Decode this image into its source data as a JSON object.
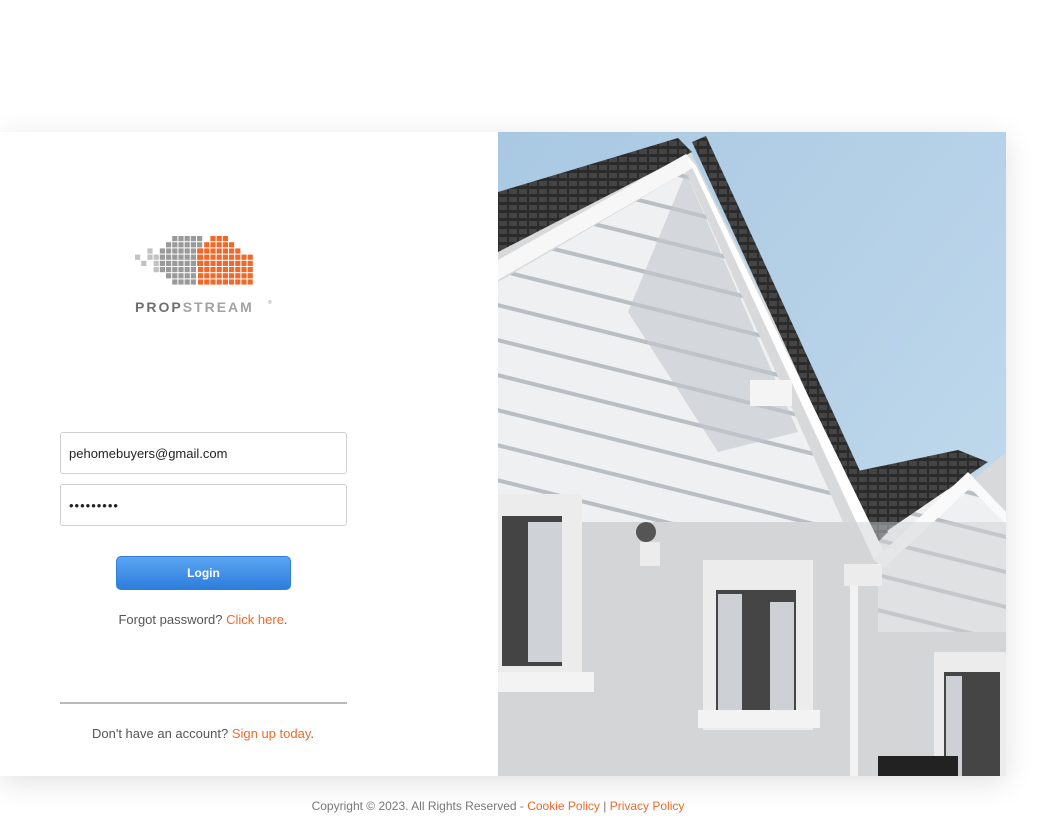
{
  "brand": {
    "name_part1": "PROP",
    "name_part2": "STREAM",
    "reg": "®"
  },
  "form": {
    "email_value": "pehomebuyers@gmail.com",
    "password_value": "•••••••••",
    "login_label": "Login"
  },
  "forgot": {
    "text": "Forgot password? ",
    "link": "Click here",
    "suffix": "."
  },
  "signup": {
    "text": "Don't have an account? ",
    "link": "Sign up today",
    "suffix": "."
  },
  "footer": {
    "copyright": "Copyright © 2023. All Rights Reserved - ",
    "cookie_link": "Cookie Policy",
    "separator": " | ",
    "privacy_link": "Privacy Policy"
  },
  "colors": {
    "accent": "#ef6a2a",
    "button": "#2d7ddb",
    "logo_gray": "#9a9a9a"
  },
  "hero_image": "house-facade-photo"
}
